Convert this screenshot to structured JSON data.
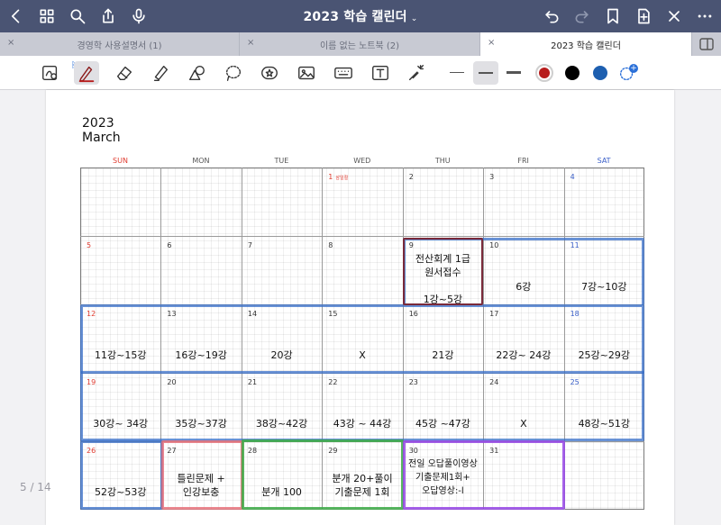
{
  "window": {
    "title": "2023 학습 캘린더"
  },
  "tabs": [
    {
      "label": "경영학 사용설명서 (1)",
      "close": "×"
    },
    {
      "label": "이름 없는 노트북 (2)",
      "close": "×"
    },
    {
      "label": "2023 학습 캘린더",
      "close": "×"
    }
  ],
  "toolbar": {
    "bluetooth_badge": "ᛒ",
    "colors": [
      "#b71c1c",
      "#000000",
      "#1d5fb0"
    ]
  },
  "page_indicator": "5 / 14",
  "calendar": {
    "year": "2023",
    "month": "March",
    "weekdays": [
      "SUN",
      "MON",
      "TUE",
      "WED",
      "THU",
      "FRI",
      "SAT"
    ],
    "holiday_label": "삼일절",
    "weeks": [
      [
        {
          "day": ""
        },
        {
          "day": ""
        },
        {
          "day": ""
        },
        {
          "day": "1",
          "holiday": true
        },
        {
          "day": "2"
        },
        {
          "day": "3"
        },
        {
          "day": "4"
        }
      ],
      [
        {
          "day": "5"
        },
        {
          "day": "6"
        },
        {
          "day": "7"
        },
        {
          "day": "8"
        },
        {
          "day": "9",
          "entry": "전산회계 1급\n원서접수\n\n1강~5강"
        },
        {
          "day": "10",
          "entry": "6강"
        },
        {
          "day": "11",
          "entry": "7강~10강"
        }
      ],
      [
        {
          "day": "12",
          "entry": "11강~15강"
        },
        {
          "day": "13",
          "entry": "16강~19강"
        },
        {
          "day": "14",
          "entry": "20강"
        },
        {
          "day": "15",
          "entry": "X"
        },
        {
          "day": "16",
          "entry": "21강"
        },
        {
          "day": "17",
          "entry": "22강~ 24강"
        },
        {
          "day": "18",
          "entry": "25강~29강"
        }
      ],
      [
        {
          "day": "19",
          "entry": "30강~ 34강"
        },
        {
          "day": "20",
          "entry": "35강~37강"
        },
        {
          "day": "21",
          "entry": "38강~42강"
        },
        {
          "day": "22",
          "entry": "43강 ~ 44강"
        },
        {
          "day": "23",
          "entry": "45강 ~47강"
        },
        {
          "day": "24",
          "entry": "X"
        },
        {
          "day": "25",
          "entry": "48강~51강"
        }
      ],
      [
        {
          "day": "26",
          "entry": "52강~53강"
        },
        {
          "day": "27",
          "entry": "틀린문제 +\n인강보충"
        },
        {
          "day": "28",
          "entry": "분개 100"
        },
        {
          "day": "29",
          "entry": "분개 20+풀이\n기출문제 1회"
        },
        {
          "day": "30",
          "entry": "전일 오답풀이영상\n기출문제1회+\n오답영상:-l"
        },
        {
          "day": "31"
        },
        {
          "day": ""
        }
      ]
    ]
  }
}
